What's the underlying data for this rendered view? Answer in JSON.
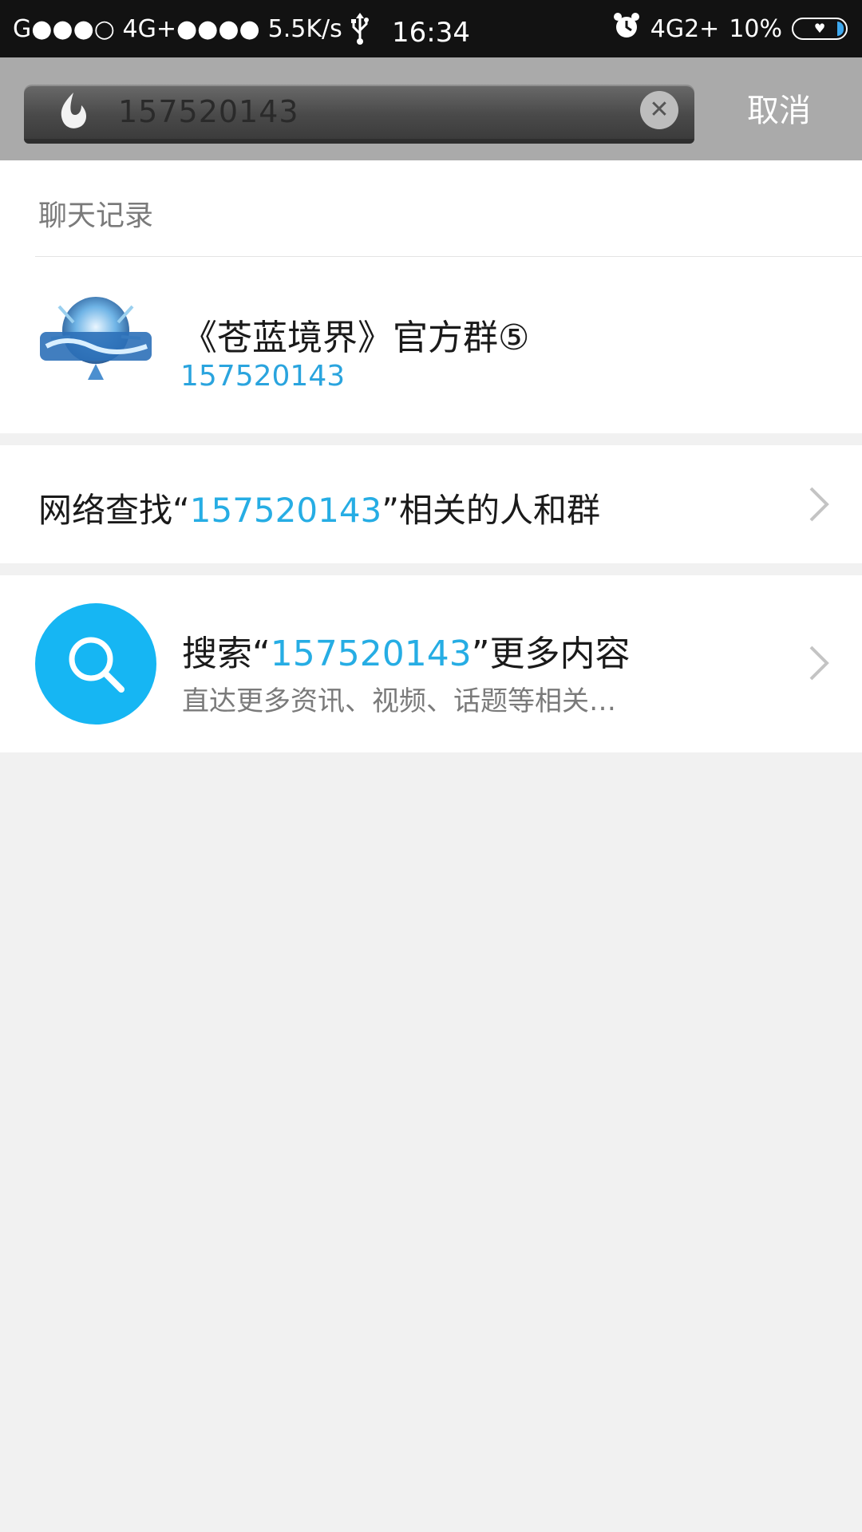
{
  "status_bar": {
    "signal": "G●●●○ 4G+●●●●",
    "speed": "5.5K/s",
    "time": "16:34",
    "network2": "4G2+",
    "battery_percent": "10%",
    "battery_level": 0.1
  },
  "search": {
    "query": "157520143",
    "cancel_label": "取消"
  },
  "chat_record": {
    "section_title": "聊天记录",
    "result": {
      "name": "《苍蓝境界》官方群⑤",
      "number": "157520143"
    }
  },
  "network_find": {
    "prefix": "网络查找“",
    "keyword": "157520143",
    "suffix": "”相关的人和群"
  },
  "search_more": {
    "prefix": "搜索“",
    "keyword": "157520143",
    "suffix": "”更多内容",
    "subtitle": "直达更多资讯、视频、话题等相关…"
  },
  "colors": {
    "accent": "#26ade4",
    "search_circle": "#16b6f3",
    "header_bg": "#aaaaaa",
    "status_bg": "#121212"
  },
  "icons": [
    "usb-icon",
    "alarm-icon",
    "battery-icon",
    "flame-icon",
    "clear-icon",
    "chevron-right-icon",
    "search-icon"
  ]
}
